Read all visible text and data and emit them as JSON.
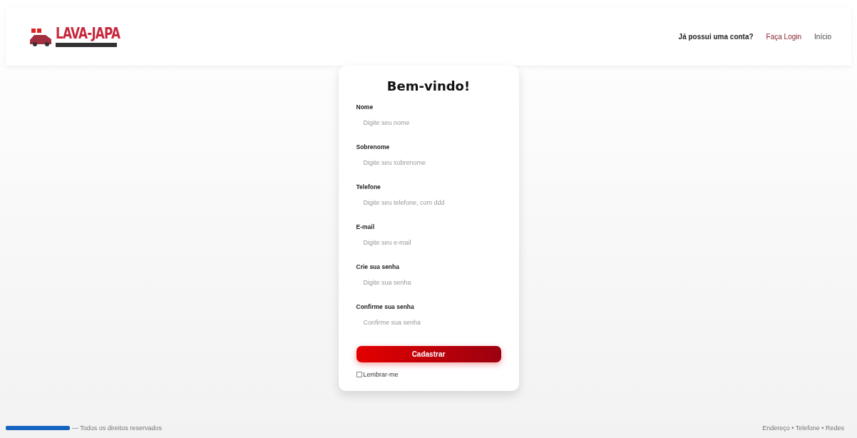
{
  "header": {
    "logo": {
      "title": "LAVA-JAPA"
    },
    "nav": [
      {
        "kind": "text",
        "label": "Já possui uma conta?"
      },
      {
        "kind": "link",
        "label": "Faça Login"
      },
      {
        "kind": "link",
        "label": "Início"
      }
    ]
  },
  "form": {
    "title": "Bem-vindo!",
    "fields": [
      {
        "label": "Nome",
        "placeholder": "Digite seu nome"
      },
      {
        "label": "Sobrenome",
        "placeholder": "Digite seu sobrenome"
      },
      {
        "label": "Telefone",
        "placeholder": "Digite seu telefone, com ddd"
      },
      {
        "label": "E-mail",
        "placeholder": "Digite seu e-mail"
      },
      {
        "label": "Crie sua senha",
        "placeholder": "Digite sua senha"
      },
      {
        "label": "Confirme sua senha",
        "placeholder": "Confirme sua senha"
      }
    ],
    "submit": "Cadastrar",
    "remember": {
      "label": "Lembrar-me",
      "checked": false
    }
  },
  "footer": {
    "left": "— Todos os direitos reservados",
    "right": "Endereço • Telefone • Redes"
  }
}
